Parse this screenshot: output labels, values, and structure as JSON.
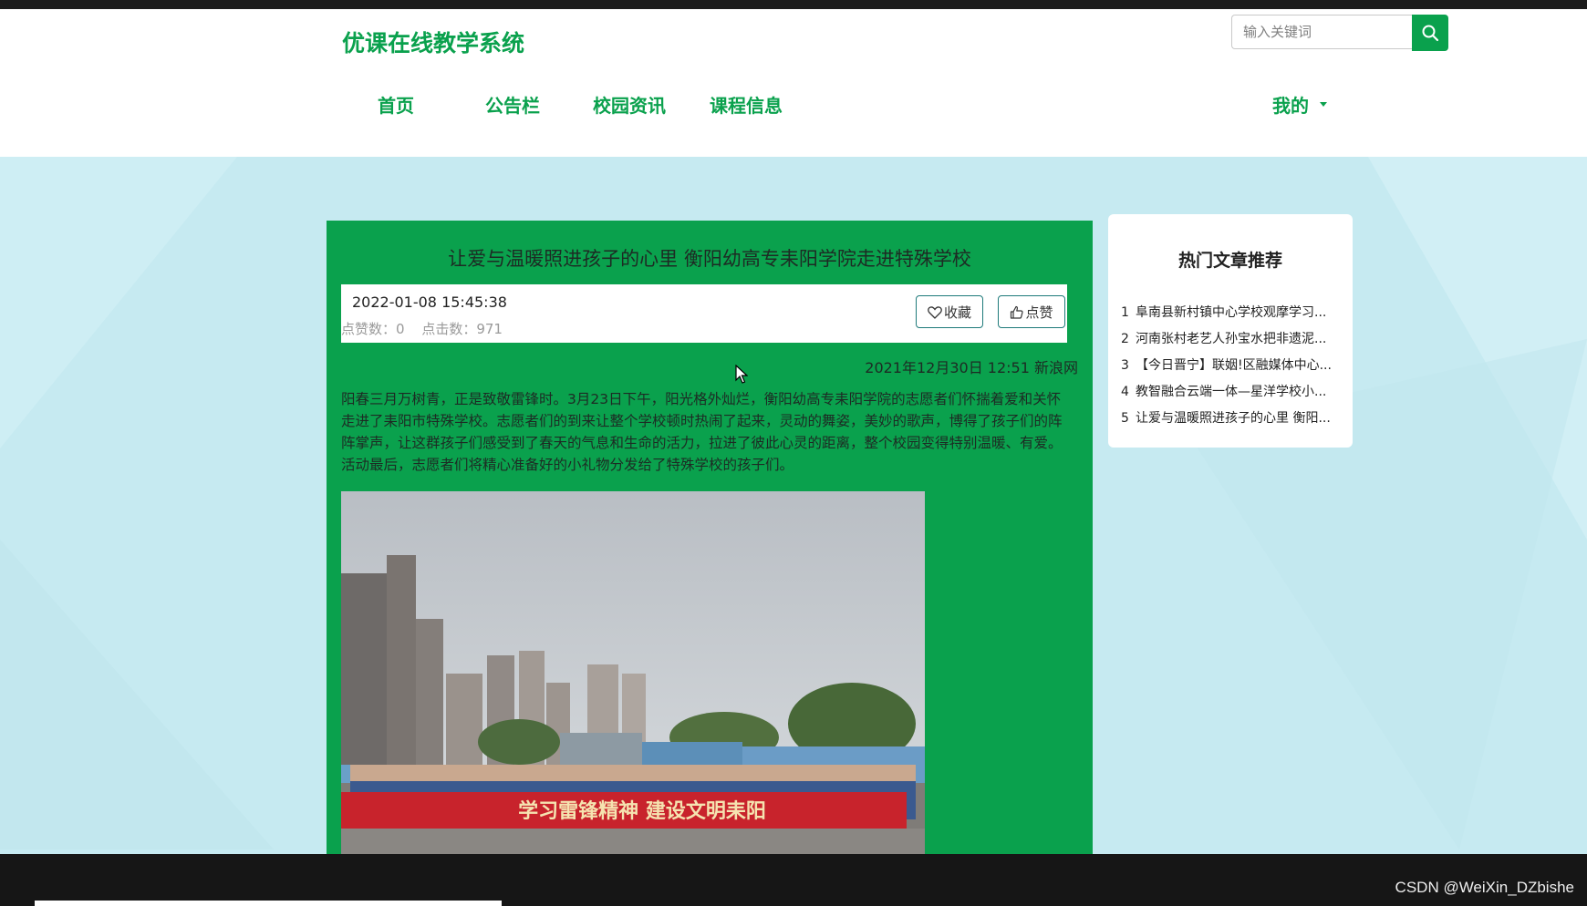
{
  "header": {
    "site_title": "优课在线教学系统",
    "search_placeholder": "输入关键词",
    "nav": [
      "首页",
      "公告栏",
      "校园资讯",
      "课程信息"
    ],
    "user_menu": "我的"
  },
  "article": {
    "title": "让爱与温暖照进孩子的心里 衡阳幼高专耒阳学院走进特殊学校",
    "publish_time": "2022-01-08 15:45:38",
    "likes_label": "点赞数：0",
    "clicks_label": "点击数：971",
    "favorite_label": "收藏",
    "like_label": "点赞",
    "source": "2021年12月30日 12:51 新浪网",
    "body": "阳春三月万树青，正是致敬雷锋时。3月23日下午，阳光格外灿烂，衡阳幼高专耒阳学院的志愿者们怀揣着爱和关怀走进了耒阳市特殊学校。志愿者们的到来让整个学校顿时热闹了起来，灵动的舞姿，美妙的歌声，博得了孩子们的阵阵掌声，让这群孩子们感受到了春天的气息和生命的活力，拉进了彼此心灵的距离，整个校园变得特别温暖、有爱。活动最后，志愿者们将精心准备好的小礼物分发给了特殊学校的孩子们。",
    "banner_text": "学习雷锋精神 建设文明耒阳"
  },
  "sidebar": {
    "title": "热门文章推荐",
    "items": [
      {
        "num": "1",
        "text": "阜南县新村镇中心学校观摩学习..."
      },
      {
        "num": "2",
        "text": "河南张村老艺人孙宝水把非遗泥..."
      },
      {
        "num": "3",
        "text": "【今日晋宁】联姻!区融媒体中心..."
      },
      {
        "num": "4",
        "text": "教智融合云端一体—星洋学校小..."
      },
      {
        "num": "5",
        "text": "让爱与温暖照进孩子的心里 衡阳..."
      }
    ]
  },
  "watermark": "CSDN @WeiXin_DZbishe",
  "colors": {
    "accent": "#0aa14d",
    "page_bg": "#c6eaf1"
  }
}
